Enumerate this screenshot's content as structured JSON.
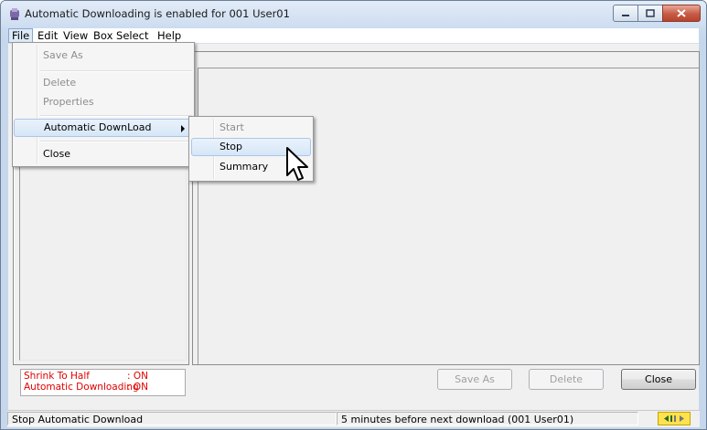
{
  "window": {
    "title": "Automatic Downloading is enabled for 001 User01",
    "controls": [
      "minimize-icon",
      "maximize-icon",
      "close-icon"
    ]
  },
  "menubar": {
    "items": [
      "File",
      "Edit",
      "View",
      "Box Select",
      "Help"
    ]
  },
  "file_menu": {
    "items": [
      {
        "label": "Save As",
        "enabled": false
      },
      {
        "label": "Delete",
        "enabled": false
      },
      {
        "label": "Properties",
        "enabled": false
      },
      {
        "label": "Automatic DownLoad",
        "enabled": true,
        "submenu": true
      },
      {
        "label": "Close",
        "enabled": true
      }
    ]
  },
  "submenu": {
    "items": [
      {
        "label": "Start",
        "enabled": false
      },
      {
        "label": "Stop",
        "enabled": true,
        "highlighted": true
      },
      {
        "label": "Summary",
        "enabled": true
      }
    ]
  },
  "status_box": {
    "rows": [
      {
        "key": "Shrink To Half",
        "value": ": ON"
      },
      {
        "key": "Automatic Downloading",
        "value": ": ON"
      }
    ],
    "color": "#e00000"
  },
  "buttons": {
    "save_as": "Save As",
    "delete": "Delete",
    "close": "Close"
  },
  "statusbar": {
    "left": "Stop Automatic Download",
    "middle": "5 minutes before next download (001 User01)",
    "indicator_color": "#ffe24d"
  }
}
